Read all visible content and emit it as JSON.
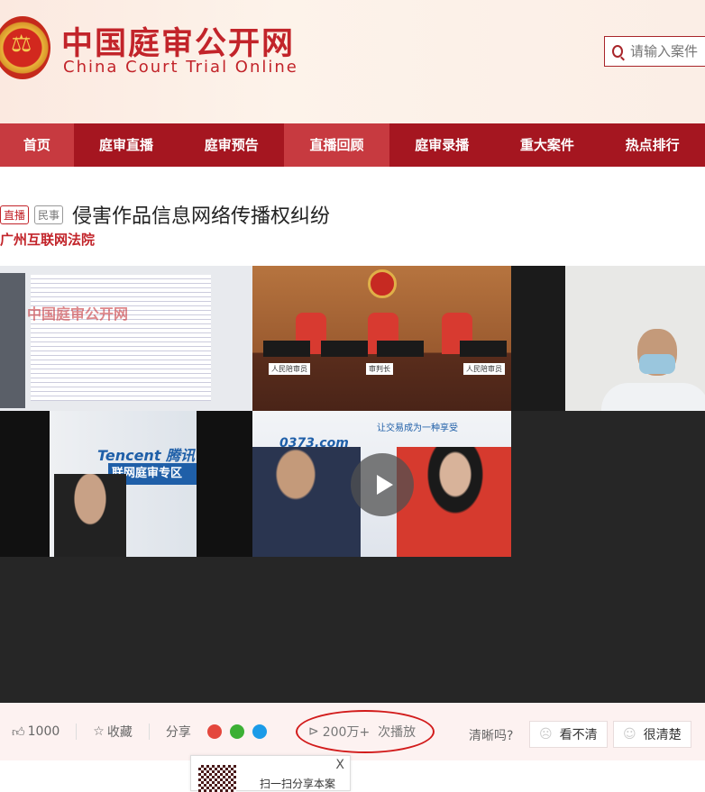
{
  "header": {
    "logo_cn": "中国庭审公开网",
    "logo_en": "China Court Trial Online",
    "search_placeholder": "请输入案件"
  },
  "nav": [
    "首页",
    "庭审直播",
    "庭审预告",
    "直播回顾",
    "庭审录播",
    "重大案件",
    "热点排行"
  ],
  "case": {
    "tag_live": "直播",
    "tag_type": "民事",
    "title": "侵害作品信息网络传播权纠纷",
    "court": "广州互联网法院"
  },
  "video": {
    "watermark": "中国庭审公开网",
    "plates": [
      "人民陪审员",
      "审判长",
      "人民陪审员"
    ],
    "brand": "Tencent 腾讯",
    "band": "联网庭审专区",
    "site": "0373.com",
    "slogan": "让交易成为一种享受"
  },
  "actions": {
    "likes": "1000",
    "favorite": "收藏",
    "share": "分享",
    "views": "200万+",
    "views_suffix": "次播放",
    "clarity_q": "清晰吗?",
    "unclear": "看不清",
    "clear": "很清楚"
  },
  "share_popup": {
    "text": "扫一扫分享本案",
    "close": "X"
  },
  "colors": {
    "brand": "#c2242a",
    "nav": "#a51620",
    "nav_active": "#c73a40"
  }
}
